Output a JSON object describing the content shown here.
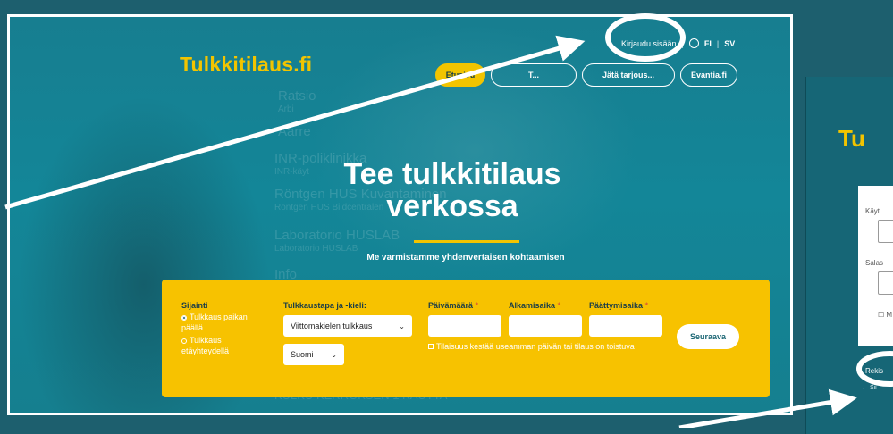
{
  "site": {
    "logo": "Tulkkitilaus.fi"
  },
  "top_links": {
    "login": "Kirjaudu sisään",
    "lang_fi": "FI",
    "lang_sv": "SV"
  },
  "nav": {
    "items": [
      {
        "label": "Etusivu",
        "active": true
      },
      {
        "label": "T...",
        "active": false
      },
      {
        "label": "Jätä tarjous...",
        "active": false
      },
      {
        "label": "Evantia.fi",
        "active": false
      }
    ]
  },
  "hero": {
    "title_line1": "Tee tulkkitilaus",
    "title_line2": "verkossa",
    "subtitle": "Me varmistamme yhdenvertaisen kohtaamisen"
  },
  "form": {
    "location_label": "Sijainti",
    "location_options": [
      {
        "label": "Tulkkaus paikan päällä",
        "selected": true
      },
      {
        "label": "Tulkkaus etäyhteydellä",
        "selected": false
      }
    ],
    "method_label": "Tulkkaustapa ja -kieli:",
    "method_value": "Viittomakielen tulkkaus",
    "language_value": "Suomi",
    "date_label": "Päivämäärä",
    "start_label": "Alkamisaika",
    "end_label": "Päättymisaika",
    "required_mark": "*",
    "multi_day_text": "Tilaisuus kestää useamman päivän tai tilaus on toistuva",
    "next_button": "Seuraava"
  },
  "background_text": {
    "lines": [
      {
        "main": "Ratsio",
        "sub": "Arbi"
      },
      {
        "main": "Aarre",
        "sub": ""
      },
      {
        "main": "INR-poliklinikka",
        "sub": "INR-käyt"
      },
      {
        "main": "Röntgen HUS Kuvantaminen",
        "sub": "Röntgen HUS Bildcentralen"
      },
      {
        "main": "Laboratorio HUSLAB",
        "sub": "Laboratorio HUSLAB"
      },
      {
        "main": "Info",
        "sub": ""
      },
      {
        "main": "KULKU KERROKSEN 1 KAUTTA",
        "sub": ""
      }
    ]
  },
  "right_panel": {
    "logo_partial": "Tu",
    "username_label": "Käyt",
    "password_label": "Salas",
    "remember_partial": "M",
    "register_partial": "Rekis",
    "back_partial": "← Sii"
  },
  "colors": {
    "brand_yellow": "#f2c400",
    "teal_bg": "#138698",
    "annotation_white": "#ffffff"
  }
}
